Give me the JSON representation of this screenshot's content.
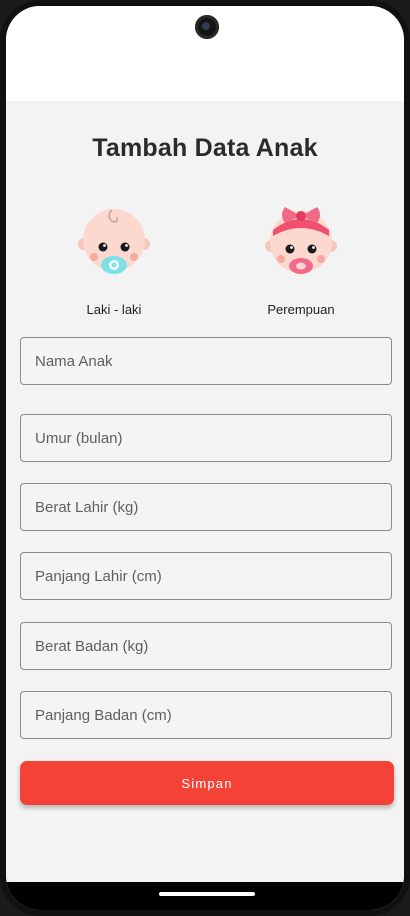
{
  "page": {
    "title": "Tambah Data Anak"
  },
  "genders": {
    "male": {
      "label": "Laki - laki",
      "icon": "baby-boy-icon"
    },
    "female": {
      "label": "Perempuan",
      "icon": "baby-girl-icon"
    }
  },
  "form": {
    "fields": [
      {
        "placeholder": "Nama Anak",
        "value": ""
      },
      {
        "placeholder": "Umur (bulan)",
        "value": ""
      },
      {
        "placeholder": "Berat Lahir (kg)",
        "value": ""
      },
      {
        "placeholder": "Panjang Lahir (cm)",
        "value": ""
      },
      {
        "placeholder": "Berat Badan (kg)",
        "value": ""
      },
      {
        "placeholder": "Panjang Badan (cm)",
        "value": ""
      }
    ],
    "submit_label": "Simpan"
  },
  "colors": {
    "accent": "#f44336",
    "background": "#f3f3f3"
  }
}
